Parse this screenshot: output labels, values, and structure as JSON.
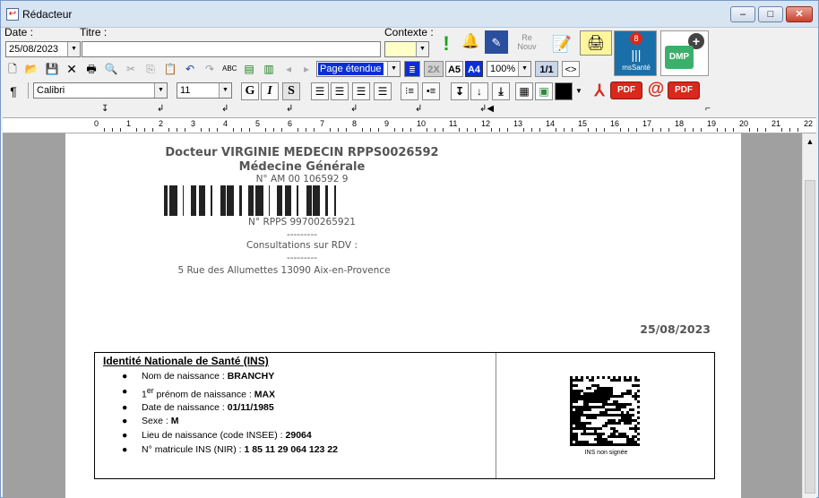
{
  "window": {
    "title": "Rédacteur",
    "min_glyph": "–",
    "max_glyph": "□",
    "close_glyph": "✕"
  },
  "fields": {
    "date_label": "Date :",
    "date_value": "25/08/2023",
    "title_label": "Titre :",
    "title_value": "",
    "context_label": "Contexte :",
    "context_value": ""
  },
  "toolbar": {
    "view_mode": "Page étendue",
    "zoom": "100%",
    "page_indicator": "1/1",
    "font_name": "Calibri",
    "font_size": "11",
    "bold_label": "G",
    "italic_label": "I",
    "underline_label": "S",
    "size_2x_label": "2X",
    "a5_label": "A5",
    "a4_label": "A4",
    "code_label": "<>",
    "pdf_label": "PDF",
    "pdf_label_2": "PDF",
    "renouv_label": "Re\nNouv",
    "mssante_label": "msSanté",
    "dmp_label": "DMP",
    "mssante_badge": "8",
    "pilcrow": "¶",
    "at_sign": "@"
  },
  "icons": [
    "new-document-icon",
    "open-folder-icon",
    "save-icon",
    "delete-icon",
    "print-icon",
    "print-preview-icon",
    "cut-icon",
    "copy-icon",
    "paste-icon",
    "undo-icon",
    "redo-icon",
    "spellcheck-icon",
    "insert-field-icon",
    "insert-list-icon",
    "prev-icon",
    "next-icon",
    "alert-icon",
    "bell-icon",
    "book-icon",
    "renouv-icon",
    "edit-form-icon",
    "scanner-icon",
    "mssante-icon",
    "dmp-icon",
    "align-left-icon",
    "align-right-icon",
    "align-center-icon",
    "justify-icon",
    "numbered-list-icon",
    "bullet-list-icon",
    "table-icon",
    "image-icon",
    "color-icon",
    "pdf-icon",
    "email-icon"
  ],
  "ruler": {
    "numbers": [
      "0",
      "1",
      "2",
      "3",
      "4",
      "5",
      "6",
      "7",
      "8",
      "9",
      "10",
      "11",
      "12",
      "13",
      "14",
      "15",
      "16",
      "17",
      "18",
      "19",
      "20",
      "21",
      "22"
    ]
  },
  "document": {
    "doctor_name": "Docteur VIRGINIE MEDECIN RPPS0026592",
    "specialty": "Médecine Générale",
    "am_number": "N° AM 00 106592 9",
    "rpps_number": "N° RPPS 99700265921",
    "dashes_1": "---------",
    "consultations": "Consultations sur RDV :",
    "dashes_2": "---------",
    "address": "5 Rue des Allumettes 13090 Aix-en-Provence",
    "date": "25/08/2023",
    "ins": {
      "title": "Identité Nationale de Santé (INS)",
      "items": [
        {
          "label": "Nom de naissance : ",
          "value": "BRANCHY"
        },
        {
          "label_pre": "1",
          "sup": "er",
          "label": " prénom de naissance : ",
          "value": "MAX"
        },
        {
          "label": "Date de naissance : ",
          "value": "01/11/1985"
        },
        {
          "label": "Sexe : ",
          "value": "M"
        },
        {
          "label": "Lieu de naissance (code INSEE) : ",
          "value": "29064"
        },
        {
          "label": "N° matricule INS (NIR) : ",
          "value": "1 85 11 29 064 123 22"
        }
      ],
      "qr_caption": "INS non signée"
    }
  },
  "colors": {
    "titlebar": "#d7e4f2",
    "workspace": "#a0a0a0",
    "alert_green": "#1fa01f",
    "pdf_red": "#d9281c",
    "mssante_blue": "#1b6fa8",
    "dmp_green": "#3bb06a",
    "selected_blue": "#0a2fd6"
  }
}
